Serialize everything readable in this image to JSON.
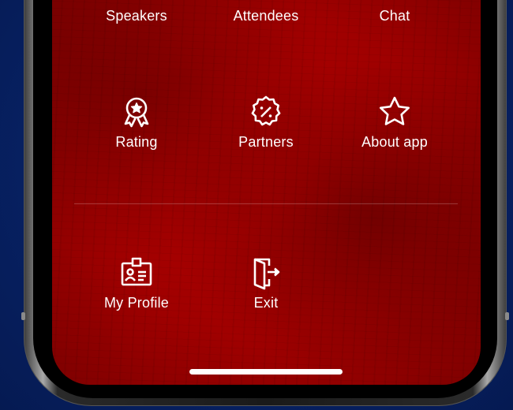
{
  "menu": {
    "row1": [
      {
        "label": "Speakers"
      },
      {
        "label": "Attendees"
      },
      {
        "label": "Chat"
      }
    ],
    "row2": [
      {
        "label": "Rating",
        "icon": "award-badge-icon"
      },
      {
        "label": "Partners",
        "icon": "discount-badge-icon"
      },
      {
        "label": "About app",
        "icon": "star-icon"
      }
    ],
    "row3": [
      {
        "label": "My Profile",
        "icon": "id-card-icon"
      },
      {
        "label": "Exit",
        "icon": "exit-door-icon"
      }
    ]
  },
  "colors": {
    "screen_red": "#a00000",
    "background_blue": "#082368",
    "text": "#ffffff"
  }
}
